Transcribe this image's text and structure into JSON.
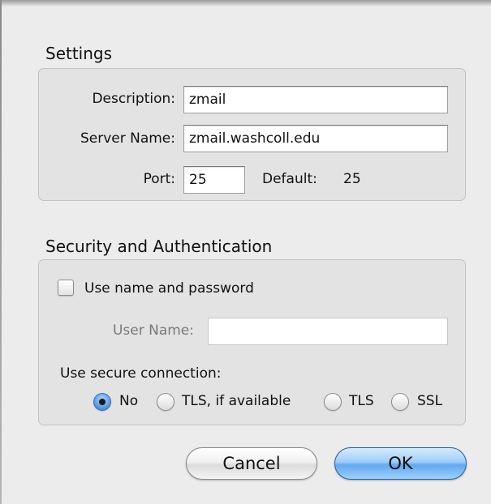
{
  "settings": {
    "title": "Settings",
    "description_label": "Description:",
    "description_value": "zmail",
    "server_name_label": "Server Name:",
    "server_name_value": "zmail.washcoll.edu",
    "port_label": "Port:",
    "port_value": "25",
    "default_label": "Default:",
    "default_value": "25"
  },
  "security": {
    "title": "Security and Authentication",
    "use_name_password_label": "Use name and password",
    "use_name_password_checked": false,
    "user_name_label": "User Name:",
    "user_name_value": "",
    "secure_connection_label": "Use secure connection:",
    "options": [
      {
        "label": "No",
        "selected": true
      },
      {
        "label": "TLS, if available",
        "selected": false
      },
      {
        "label": "TLS",
        "selected": false
      },
      {
        "label": "SSL",
        "selected": false
      }
    ]
  },
  "buttons": {
    "cancel": "Cancel",
    "ok": "OK"
  },
  "colors": {
    "window_bg": "#ececec",
    "group_bg": "#e3e3e3",
    "accent": "#5a9be6"
  }
}
